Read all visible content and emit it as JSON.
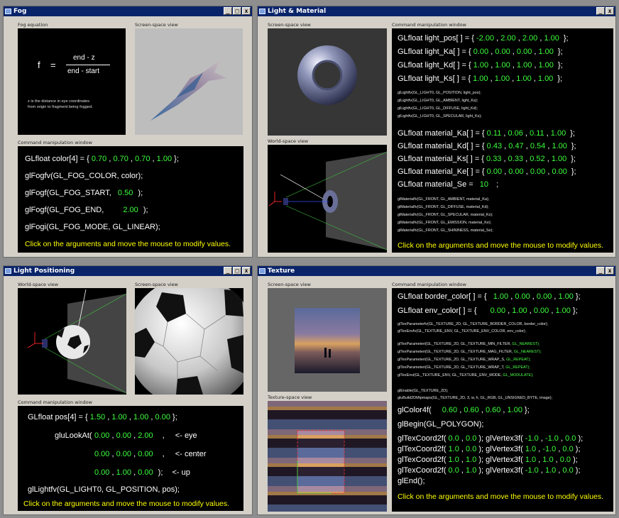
{
  "fog": {
    "title": "Fog",
    "eq_label": "Fog equation",
    "screen_label": "Screen-space view",
    "cmd_label": "Command manipulation window",
    "eq_f": "f",
    "eq_equals": "=",
    "eq_numerator": "end - z",
    "eq_denominator": "end - start",
    "note_line1": "z is the distance in eye coordinates",
    "note_line2": "from origin to fragment being fogged.",
    "color_prefix": "GLfloat color[4] = {",
    "color": [
      "0.70",
      "0.70",
      "0.70",
      "1.00"
    ],
    "color_suffix": "};",
    "fogfv": "glFogfv(GL_FOG_COLOR, color);",
    "fog_start_prefix": "glFogf(GL_FOG_START,",
    "fog_start": "0.50",
    "fog_end_prefix": "glFogf(GL_FOG_END,",
    "fog_end": "2.00",
    "close_paren": ");",
    "fogi": "glFogi(GL_FOG_MODE, GL_LINEAR);",
    "hint": "Click on the arguments and move the mouse to modify values."
  },
  "light_material": {
    "title": "Light & Material",
    "screen_label": "Screen-space view",
    "world_label": "World-space view",
    "cmd_label": "Command manipulation window",
    "light_rows": [
      {
        "name": "GLfloat light_pos[ ] = {",
        "vals": [
          "-2.00",
          "2.00",
          "2.00",
          "1.00"
        ]
      },
      {
        "name": "GLfloat light_Ka[ ] = {",
        "vals": [
          "0.00",
          "0.00",
          "0.00",
          "1.00"
        ]
      },
      {
        "name": "GLfloat light_Kd[ ] = {",
        "vals": [
          "1.00",
          "1.00",
          "1.00",
          "1.00"
        ]
      },
      {
        "name": "GLfloat light_Ks[ ] = {",
        "vals": [
          "1.00",
          "1.00",
          "1.00",
          "1.00"
        ]
      }
    ],
    "light_calls": [
      "glLightfv(GL_LIGHT0, GL_POSITION, light_pos);",
      "glLightfv(GL_LIGHT0, GL_AMBIENT, light_Ka);",
      "glLightfv(GL_LIGHT0, GL_DIFFUSE, light_Kd);",
      "glLightfv(GL_LIGHT0, GL_SPECULAR, light_Ks);"
    ],
    "material_rows": [
      {
        "name": "GLfloat material_Ka[ ] = {",
        "vals": [
          "0.11",
          "0.06",
          "0.11",
          "1.00"
        ]
      },
      {
        "name": "GLfloat material_Kd[ ] = {",
        "vals": [
          "0.43",
          "0.47",
          "0.54",
          "1.00"
        ]
      },
      {
        "name": "GLfloat material_Ks[ ] = {",
        "vals": [
          "0.33",
          "0.33",
          "0.52",
          "1.00"
        ]
      },
      {
        "name": "GLfloat material_Ke[ ] = {",
        "vals": [
          "0.00",
          "0.00",
          "0.00",
          "0.00"
        ]
      }
    ],
    "se_prefix": "GLfloat material_Se =",
    "se": "10",
    "semicolon": ";",
    "material_calls": [
      "glMaterialfv(GL_FRONT, GL_AMBIENT, material_Ka);",
      "glMaterialfv(GL_FRONT, GL_DIFFUSE, material_Kd);",
      "glMaterialfv(GL_FRONT, GL_SPECULAR, material_Ks);",
      "glMaterialfv(GL_FRONT, GL_EMISSION, material_Ke);",
      "glMaterialfv(GL_FRONT, GL_SHININESS, material_Se);"
    ],
    "hint": "Click on the arguments and move the mouse to modify values."
  },
  "light_positioning": {
    "title": "Light Positioning",
    "world_label": "World-space view",
    "screen_label": "Screen-space view",
    "cmd_label": "Command manipulation window",
    "pos_prefix": "GLfloat pos[4] = {",
    "pos": [
      "1.50",
      "1.00",
      "1.00",
      "0.00"
    ],
    "lookat_prefix": "gluLookAt(",
    "eye": [
      "0.00",
      "0.00",
      "2.00"
    ],
    "center": [
      "0.00",
      "0.00",
      "0.00"
    ],
    "up": [
      "0.00",
      "1.00",
      "0.00"
    ],
    "eye_label": "<- eye",
    "center_label": "<- center",
    "up_label": "<- up",
    "lightfv": "glLightfv(GL_LIGHT0, GL_POSITION, pos);",
    "hint": "Click on the arguments and move the mouse to modify values."
  },
  "texture": {
    "title": "Texture",
    "screen_label": "Screen-space view",
    "texspace_label": "Texture-space view",
    "cmd_label": "Command manipulation window",
    "border_prefix": "GLfloat border_color[ ] = {",
    "border": [
      "1.00",
      "0.00",
      "0.00",
      "1.00"
    ],
    "env_prefix": "GLfloat env_color[ ] = {",
    "env": [
      "0.00",
      "1.00",
      "0.00",
      "1.00"
    ],
    "texparam_white": [
      "glTexParameterfv(GL_TEXTURE_2D, GL_TEXTURE_BORDER_COLOR, border_color);",
      "glTexEnvfv(GL_TEXTURE_ENV, GL_TEXTURE_ENV_COLOR, env_color);"
    ],
    "texparam_rows": [
      {
        "text": "glTexParameteri(GL_TEXTURE_2D, GL_TEXTURE_MIN_FILTER,",
        "arg": "GL_NEAREST);"
      },
      {
        "text": "glTexParameteri(GL_TEXTURE_2D, GL_TEXTURE_MAG_FILTER,",
        "arg": "GL_NEAREST);"
      },
      {
        "text": "glTexParameteri(GL_TEXTURE_2D, GL_TEXTURE_WRAP_S,",
        "arg": "GL_REPEAT);"
      },
      {
        "text": "glTexParameteri(GL_TEXTURE_2D, GL_TEXTURE_WRAP_T,",
        "arg": "GL_REPEAT);"
      },
      {
        "text": "glTexEnvi(GL_TEXTURE_ENV, GL_TEXTURE_ENV_MODE,",
        "arg": "GL_MODULATE);"
      }
    ],
    "enable": "glEnable(GL_TEXTURE_2D);",
    "build": "gluBuild2DMipmaps(GL_TEXTURE_2D, 3, w, h, GL_RGB, GL_UNSIGNED_BYTE, image);",
    "color_prefix": "glColor4f(",
    "color": [
      "0.60",
      "0.60",
      "0.60",
      "1.00"
    ],
    "begin": "glBegin(GL_POLYGON);",
    "verts": [
      {
        "tc": [
          "0.0",
          "0.0"
        ],
        "v": [
          "-1.0",
          "-1.0",
          "0.0"
        ]
      },
      {
        "tc": [
          "1.0",
          "0.0"
        ],
        "v": [
          "1.0",
          "-1.0",
          "0.0"
        ]
      },
      {
        "tc": [
          "1.0",
          "1.0"
        ],
        "v": [
          "1.0",
          "1.0",
          "0.0"
        ]
      },
      {
        "tc": [
          "0.0",
          "1.0"
        ],
        "v": [
          "-1.0",
          "1.0",
          "0.0"
        ]
      }
    ],
    "tc_prefix": "glTexCoord2f(",
    "v_prefix": "glVertex3f(",
    "end": "glEnd();",
    "hint": "Click on the arguments and move the mouse to modify values."
  },
  "window_buttons": {
    "minimize": "_",
    "maximize": "□",
    "close": "x"
  },
  "colors": {
    "titlebar": "#0a246a",
    "value_green": "#3dff3d",
    "hint_yellow": "#ffff00",
    "frame": "#d4d0c8"
  }
}
